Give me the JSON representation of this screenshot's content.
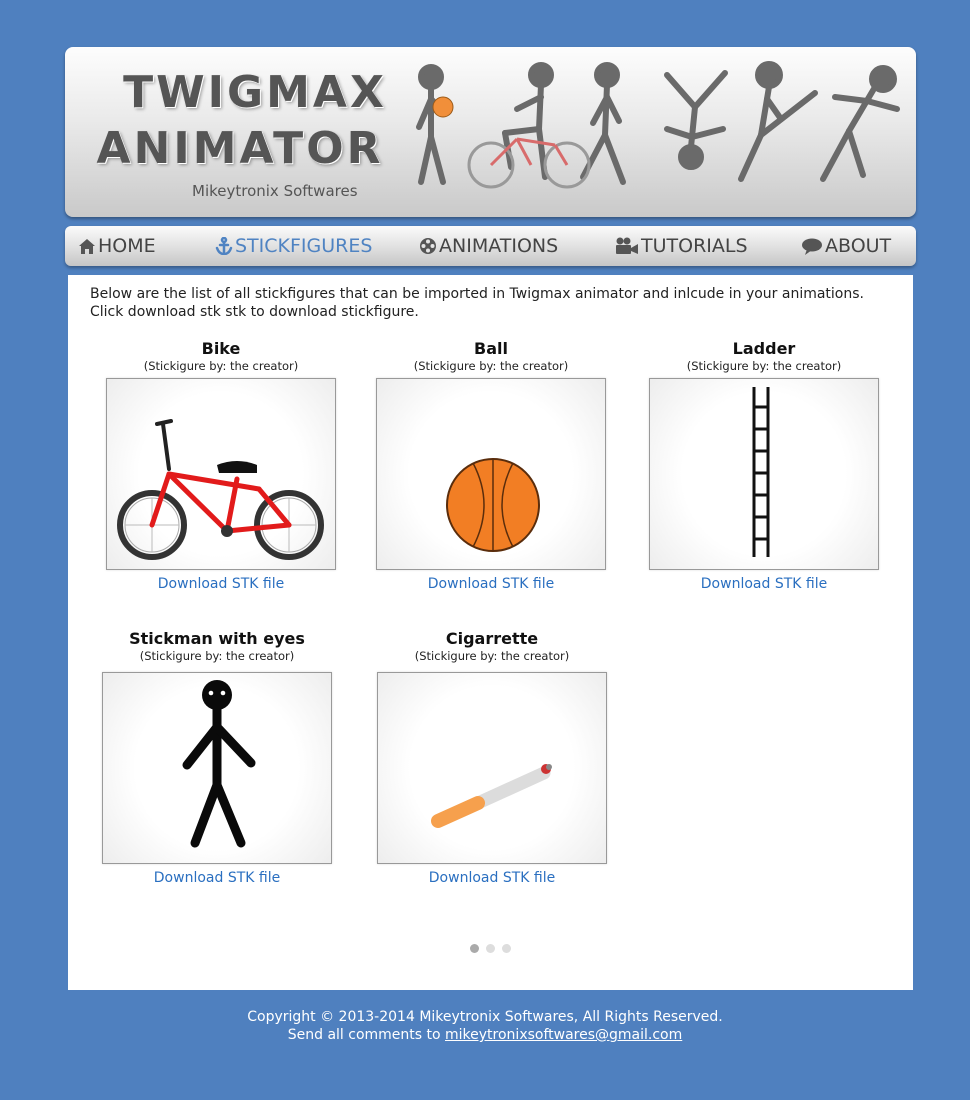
{
  "header": {
    "logo_line1": "TWIGMAX",
    "logo_line2": "ANIMATOR",
    "subtitle": "Mikeytronix Softwares"
  },
  "nav": {
    "items": [
      {
        "label": "HOME",
        "icon": "house-icon"
      },
      {
        "label": "STICKFIGURES",
        "icon": "anchor-icon",
        "active": true
      },
      {
        "label": "ANIMATIONS",
        "icon": "film-reel-icon"
      },
      {
        "label": "TUTORIALS",
        "icon": "video-camera-icon"
      },
      {
        "label": "ABOUT",
        "icon": "speech-bubble-icon"
      }
    ],
    "active_color": "#4f83c2"
  },
  "content": {
    "intro_line1": "Below are the list of all stickfigures that can be imported in Twigmax animator and inlcude in your animations.",
    "intro_line2": "Click download stk stk to download stickfigure.",
    "items": [
      {
        "title": "Bike",
        "credit": "(Stickigure by: the creator)",
        "download": "Download STK file"
      },
      {
        "title": "Ball",
        "credit": "(Stickigure by: the creator)",
        "download": "Download STK file"
      },
      {
        "title": "Ladder",
        "credit": "(Stickigure by: the creator)",
        "download": "Download STK file"
      },
      {
        "title": "Stickman with eyes",
        "credit": "(Stickigure by: the creator)",
        "download": "Download STK file"
      },
      {
        "title": "Cigarrette",
        "credit": "(Stickigure by: the creator)",
        "download": "Download STK file"
      }
    ],
    "pager": {
      "pages": 3,
      "current": 1
    }
  },
  "footer": {
    "copyright": "Copyright © 2013-2014 Mikeytronix Softwares, All Rights Reserved.",
    "comments_prefix": "Send all comments to ",
    "email": "mikeytronixsoftwares@gmail.com"
  },
  "colors": {
    "background": "#4f80bf",
    "link": "#2a6fc0"
  }
}
